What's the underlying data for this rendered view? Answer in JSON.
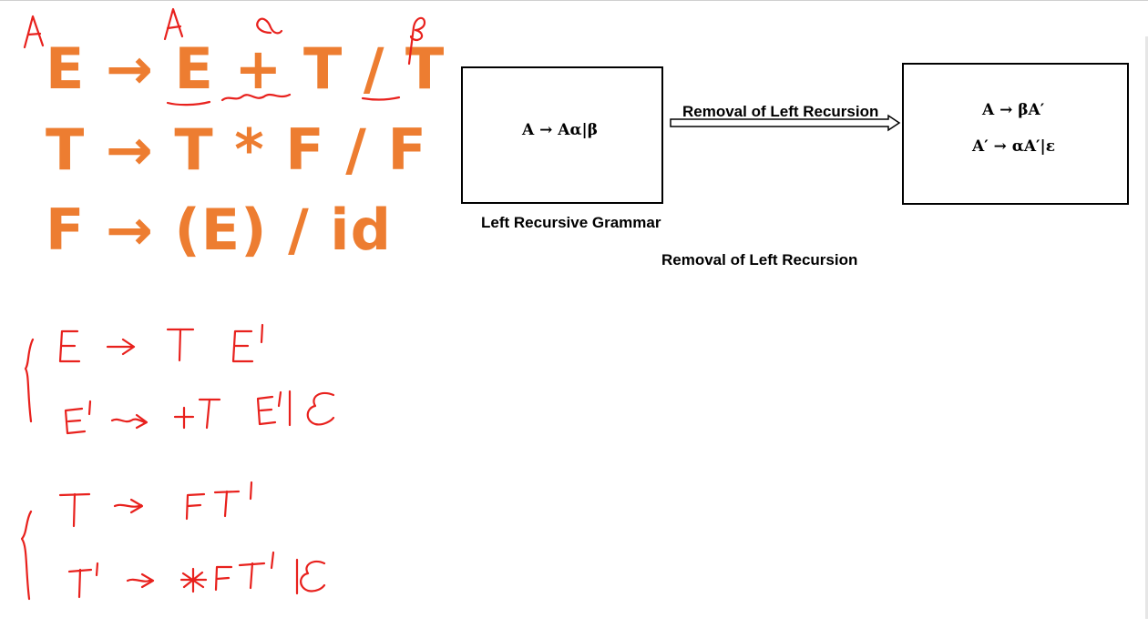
{
  "grammar": {
    "rules": [
      "E → E + T / T",
      "T → T * F / F",
      "F → (E) / id"
    ]
  },
  "diagram": {
    "left_box": {
      "formula": "A → Aα|β",
      "caption": "Left Recursive Grammar"
    },
    "arrow_label": "Removal of Left Recursion",
    "right_box": {
      "line1": "A → βA′",
      "line2": "A′ → αA′|ε"
    },
    "caption": "Removal of Left Recursion"
  },
  "annotations": {
    "labels": [
      "A",
      "A",
      "α",
      "β"
    ],
    "rules": [
      "E → T E'",
      "E' → +T E' | ε",
      "T → F T'",
      "T' → *F T' | ε"
    ]
  },
  "colors": {
    "grammar": "#ed7d31",
    "ink": "#e8211d"
  }
}
